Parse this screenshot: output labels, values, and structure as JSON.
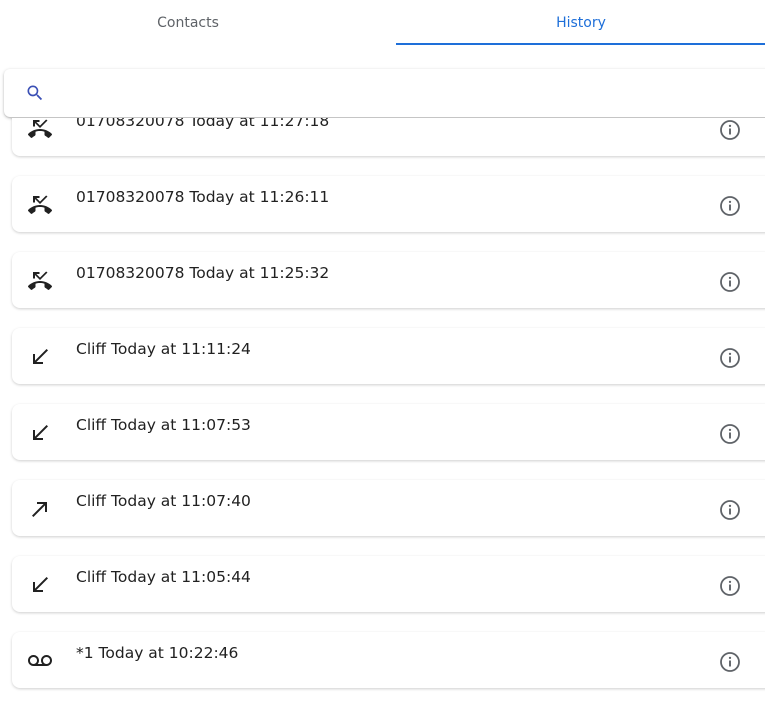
{
  "tabs": [
    {
      "label": "Contacts",
      "active": false
    },
    {
      "label": "History",
      "active": true
    }
  ],
  "accent_color": "#1e6fd9",
  "search": {
    "icon": "search-icon",
    "value": "",
    "placeholder": ""
  },
  "history": [
    {
      "text": "01708320078 Today at 11:27:18",
      "icon": "missed-call-icon"
    },
    {
      "text": "01708320078 Today at 11:26:11",
      "icon": "missed-call-icon"
    },
    {
      "text": "01708320078 Today at 11:25:32",
      "icon": "missed-call-icon"
    },
    {
      "text": "Cliff Today at 11:11:24",
      "icon": "incoming-call-icon"
    },
    {
      "text": "Cliff Today at 11:07:53",
      "icon": "incoming-call-icon"
    },
    {
      "text": "Cliff Today at 11:07:40",
      "icon": "outgoing-call-icon"
    },
    {
      "text": "Cliff Today at 11:05:44",
      "icon": "incoming-call-icon"
    },
    {
      "text": "*1 Today at 10:22:46",
      "icon": "voicemail-icon"
    }
  ],
  "info_icon": "info-icon"
}
